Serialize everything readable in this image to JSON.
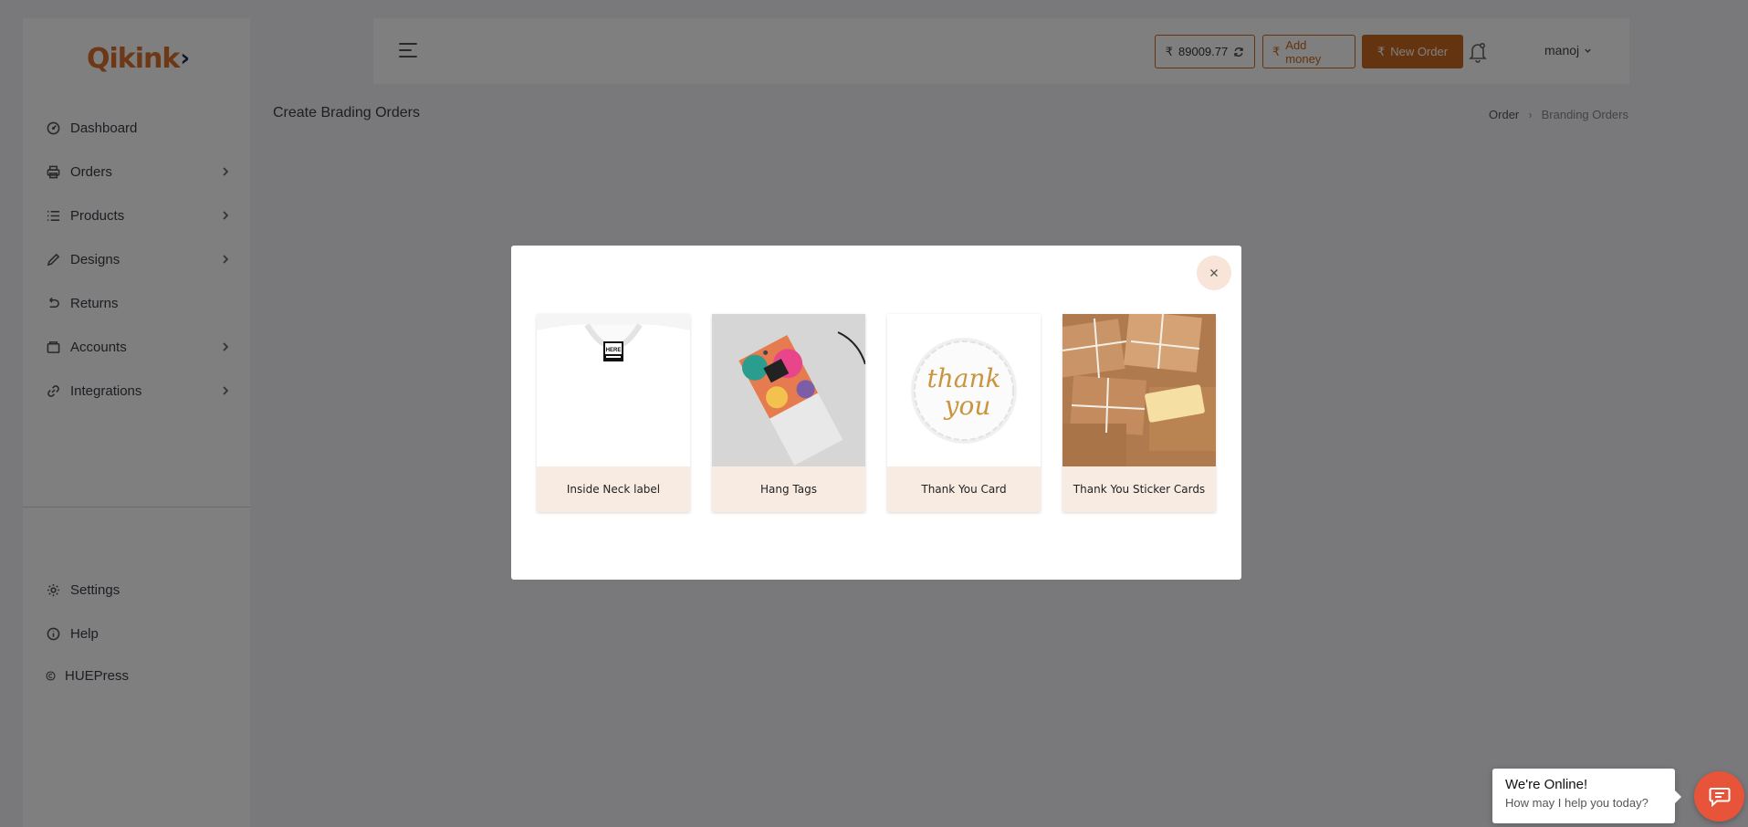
{
  "app": {
    "logo_text": "Qikink",
    "logo_arrow": "›"
  },
  "sidebar": {
    "items": [
      {
        "label": "Dashboard",
        "icon": "dashboard-icon",
        "has_chevron": false
      },
      {
        "label": "Orders",
        "icon": "printer-icon",
        "has_chevron": true
      },
      {
        "label": "Products",
        "icon": "list-icon",
        "has_chevron": true
      },
      {
        "label": "Designs",
        "icon": "pencil-icon",
        "has_chevron": true
      },
      {
        "label": "Returns",
        "icon": "undo-icon",
        "has_chevron": false
      },
      {
        "label": "Accounts",
        "icon": "wallet-icon",
        "has_chevron": true
      },
      {
        "label": "Integrations",
        "icon": "link-icon",
        "has_chevron": true
      }
    ],
    "bottom_items": [
      {
        "label": "Settings",
        "icon": "gear-icon"
      },
      {
        "label": "Help",
        "icon": "info-icon"
      },
      {
        "label": "HUEPress",
        "icon": "copyright-icon"
      }
    ]
  },
  "header": {
    "currency_symbol": "₹",
    "balance": "89009.77",
    "add_money_label": "Add money",
    "new_order_label": "New Order",
    "user_name": "manoj"
  },
  "page": {
    "title": "Create Brading Orders",
    "breadcrumb": [
      "Order",
      "Branding Orders"
    ]
  },
  "modal": {
    "cards": [
      {
        "label": "Inside Neck label",
        "image": "tshirt-neck-label-image",
        "tag_text": "HERE"
      },
      {
        "label": "Hang Tags",
        "image": "colorful-hang-tag-image"
      },
      {
        "label": "Thank You Card",
        "image": "thank-you-seal-image",
        "seal_line1": "thank",
        "seal_line2": "you"
      },
      {
        "label": "Thank You Sticker Cards",
        "image": "kraft-gift-boxes-image"
      }
    ]
  },
  "chat": {
    "title": "We're Online!",
    "subtitle": "How may I help you today?"
  },
  "colors": {
    "accent": "#c9671f",
    "logo": "#d9702a",
    "caption_bg": "#f8ebe2",
    "chat_button": "#e8543a",
    "overlay": "rgba(0,0,0,0.5)"
  }
}
